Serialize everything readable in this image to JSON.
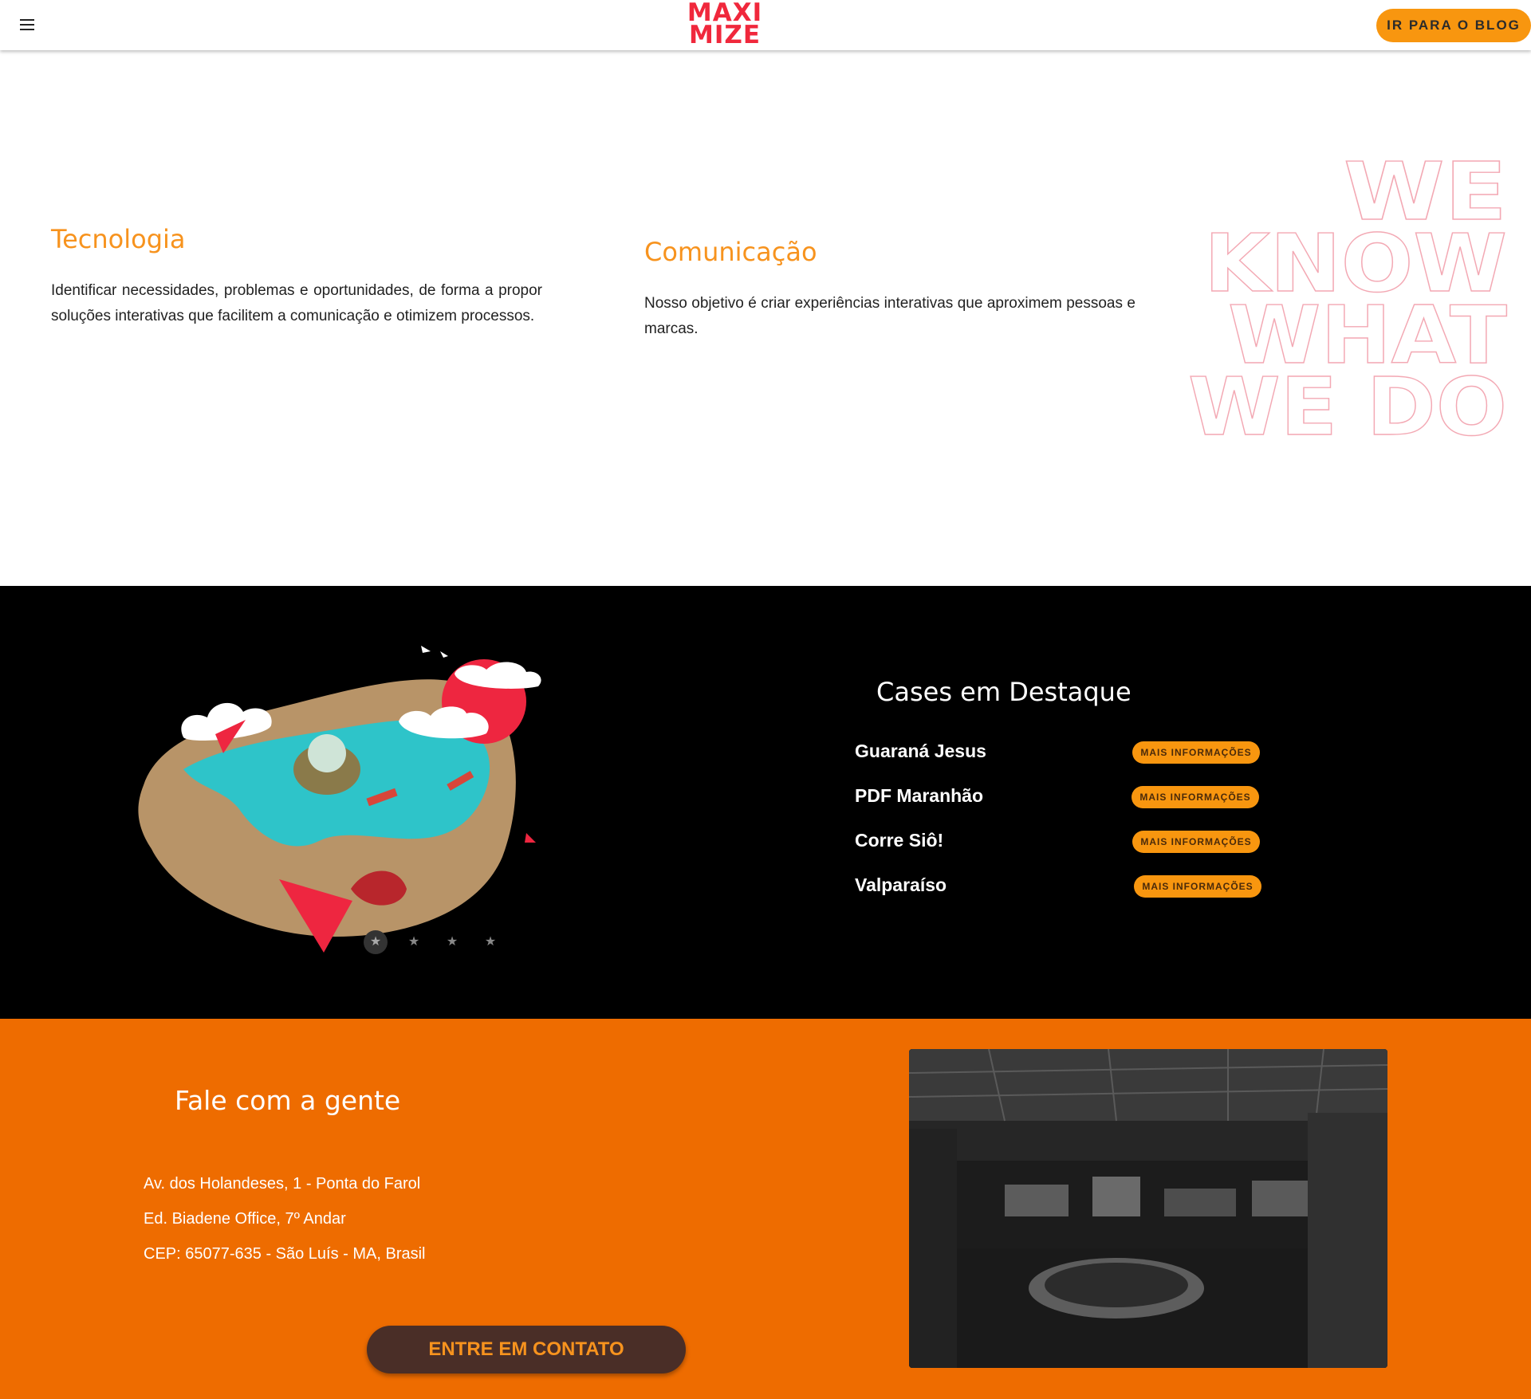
{
  "header": {
    "logo_line1": "MAXI",
    "logo_line2": "MIZE",
    "blog_button": "IR PARA O BLOG"
  },
  "intro": {
    "tecnologia": {
      "title": "Tecnologia",
      "text": "Identificar necessidades, problemas e oportunidades, de forma a propor soluções interativas que facilitem a comunicação e otimizem processos."
    },
    "comunicacao": {
      "title": "Comunicação",
      "text": "Nosso objetivo é criar experiências interativas que aproximem pessoas e marcas."
    },
    "slogan": [
      "WE",
      "KNOW",
      "WHAT",
      "WE DO"
    ]
  },
  "cases": {
    "title": "Cases em Destaque",
    "items": [
      {
        "name": "Guaraná Jesus",
        "button": "MAIS INFORMAÇÕES"
      },
      {
        "name": "PDF Maranhão",
        "button": "MAIS INFORMAÇÕES"
      },
      {
        "name": "Corre Siô!",
        "button": "MAIS INFORMAÇÕES"
      },
      {
        "name": "Valparaíso",
        "button": "MAIS INFORMAÇÕES"
      }
    ],
    "carousel_dots": [
      "star-icon",
      "star-icon",
      "star-icon",
      "star-icon"
    ],
    "active_dot": 0
  },
  "contact": {
    "title": "Fale com a gente",
    "address_line1": "Av. dos Holandeses, 1 - Ponta do Farol",
    "address_line2": "Ed. Biadene Office, 7º Andar",
    "address_line3": "CEP: 65077-635 - São Luís - MA, Brasil",
    "button": "ENTRE EM CONTATO"
  },
  "colors": {
    "brand_red": "#f0283c",
    "accent_orange": "#f8960f",
    "contact_bg": "#ee6c00",
    "dark_bg": "#000000"
  }
}
